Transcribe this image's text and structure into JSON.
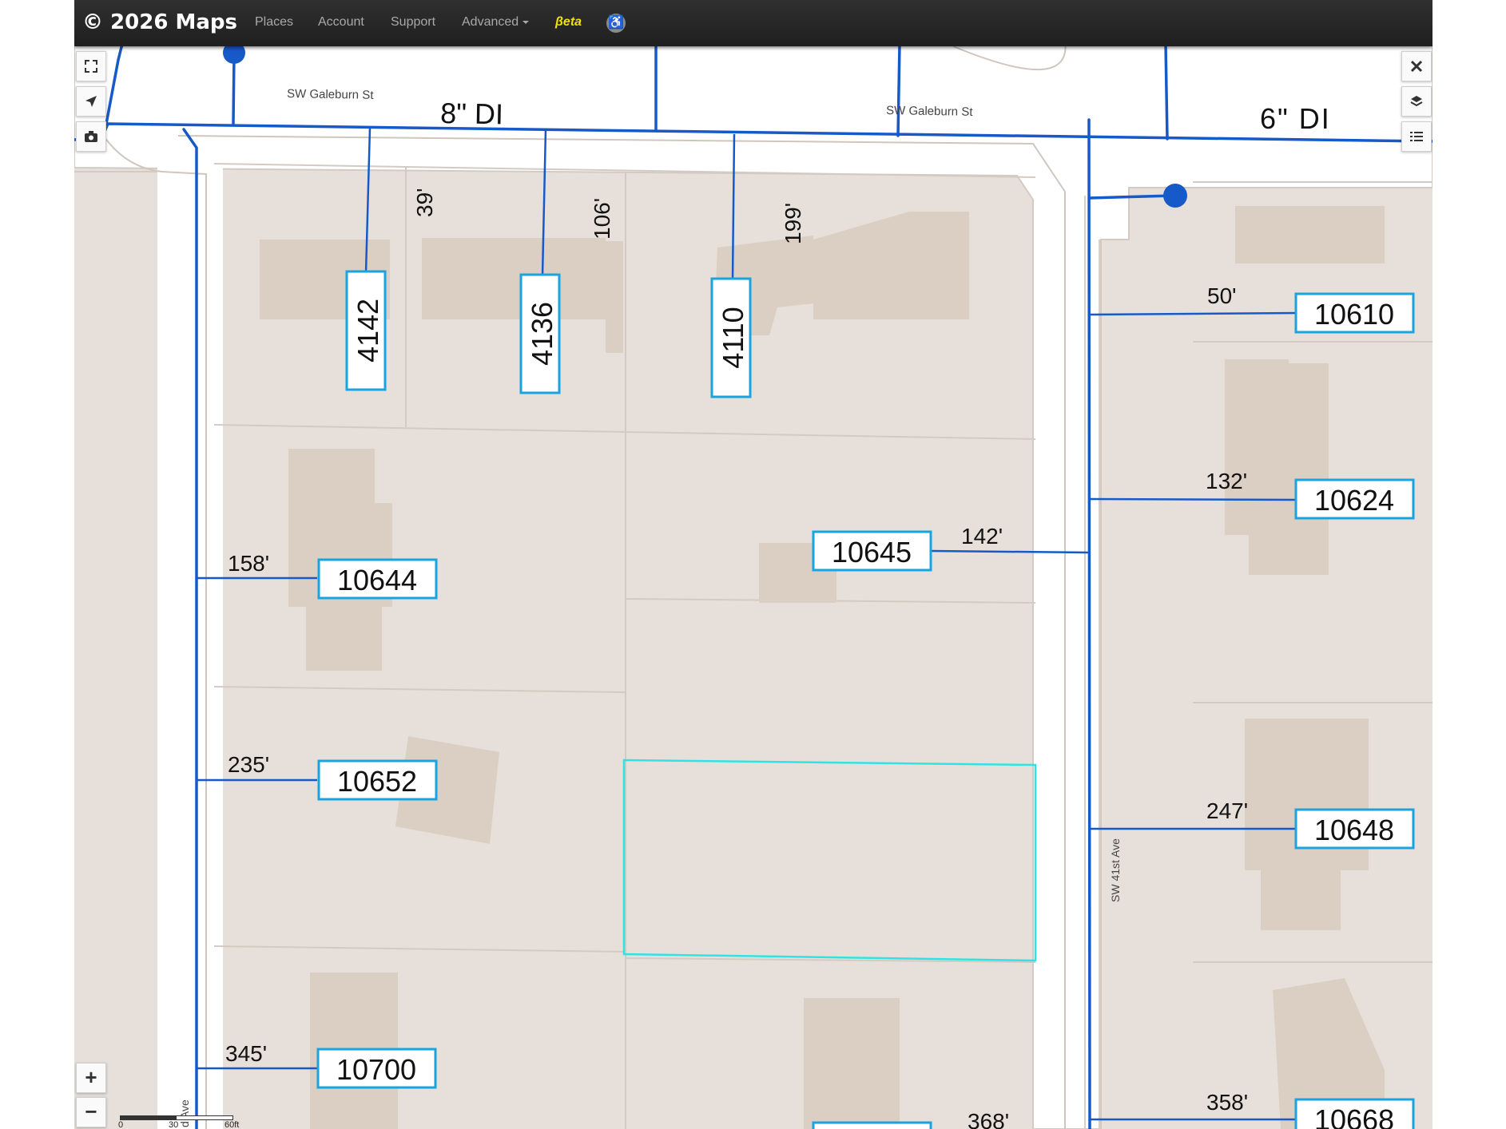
{
  "navbar": {
    "brand": "© 2026",
    "brand_rest": "Maps",
    "items": {
      "places": "Places",
      "account": "Account",
      "support": "Support",
      "advanced": "Advanced",
      "beta": "βeta"
    }
  },
  "map": {
    "streets": {
      "galeburn_w": "SW Galeburn St",
      "galeburn_e": "SW Galeburn St",
      "ave_41st": "SW 41st Ave",
      "ave_left": "d Ave"
    },
    "mains": {
      "main_west": "8\" DI",
      "main_east": "6\" DI"
    },
    "lots": {
      "l4142": "4142",
      "l4136": "4136",
      "l4110": "4110",
      "l10610": "10610",
      "l10624": "10624",
      "l10645": "10645",
      "l10644": "10644",
      "l10652": "10652",
      "l10648": "10648",
      "l10700": "10700",
      "l10668": "10668"
    },
    "distances": {
      "d39": "39'",
      "d106": "106'",
      "d199": "199'",
      "d50": "50'",
      "d132": "132'",
      "d142": "142'",
      "d158": "158'",
      "d235": "235'",
      "d247": "247'",
      "d345": "345'",
      "d358": "358'",
      "d368": "368'"
    }
  },
  "controls": {
    "zoom_in": "+",
    "zoom_out": "−"
  },
  "scale": {
    "s0": "0",
    "s30": "30",
    "s60": "60ft"
  },
  "colors": {
    "pipe": "#1659c9",
    "label_box": "#19a3df",
    "highlight": "#30e3e3",
    "parcel": "#e7e0da",
    "building": "#dbcfc3",
    "road": "#ffffff"
  }
}
